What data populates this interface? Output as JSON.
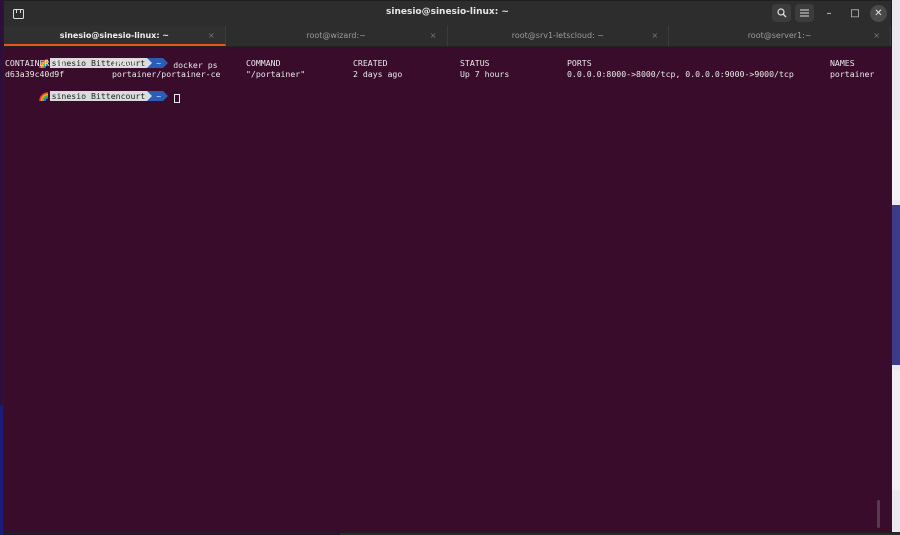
{
  "window": {
    "title": "sinesio@sinesio-linux: ~"
  },
  "titlebar": {
    "left_icon": "new-tab-icon",
    "search_icon": "search-icon",
    "menu_icon": "hamburger-icon",
    "minimize": "–",
    "maximize": "□",
    "close": "✕"
  },
  "tabs": [
    {
      "label": "sinesio@sinesio-linux: ~",
      "active": true,
      "close": "×"
    },
    {
      "label": "root@wizard:~",
      "active": false,
      "close": "×"
    },
    {
      "label": "root@srv1-letscloud: ~",
      "active": false,
      "close": "×"
    },
    {
      "label": "root@server1:~",
      "active": false,
      "close": "×"
    }
  ],
  "prompt": {
    "user": "sinesio Bittencourt",
    "path": "~"
  },
  "command": "docker ps",
  "table": {
    "headers": [
      "CONTAINER ID",
      "IMAGE",
      "COMMAND",
      "CREATED",
      "STATUS",
      "PORTS",
      "NAMES"
    ],
    "rows": [
      [
        "d63a39c40d9f",
        "portainer/portainer-ce",
        "\"/portainer\"",
        "2 days ago",
        "Up 7 hours",
        "0.0.0.0:8000->8000/tcp, 0.0.0.0:9000->9000/tcp",
        "portainer"
      ]
    ]
  },
  "colors": {
    "terminal_bg": "#380c2a",
    "titlebar_bg": "#2d2d2d",
    "active_tab_accent": "#e95420",
    "prompt_user_bg": "#dcdcdc",
    "prompt_path_bg": "#2a5db8"
  }
}
